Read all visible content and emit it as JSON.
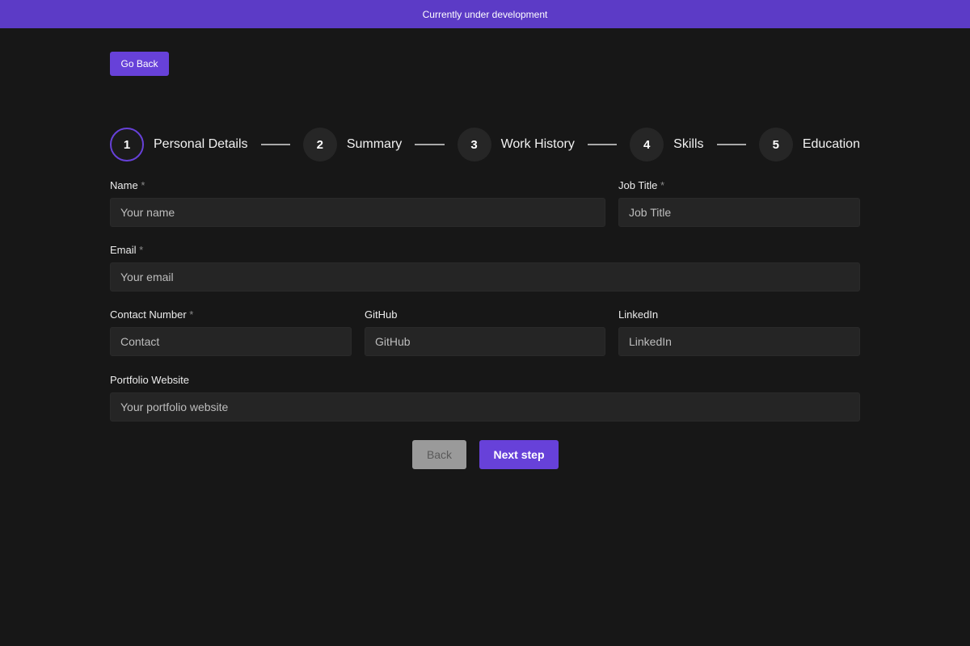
{
  "banner": {
    "text": "Currently under development"
  },
  "nav": {
    "go_back_label": "Go Back"
  },
  "stepper": {
    "steps": [
      {
        "number": "1",
        "label": "Personal Details"
      },
      {
        "number": "2",
        "label": "Summary"
      },
      {
        "number": "3",
        "label": "Work History"
      },
      {
        "number": "4",
        "label": "Skills"
      },
      {
        "number": "5",
        "label": "Education"
      }
    ],
    "active_step": 1
  },
  "form": {
    "required_marker": "*",
    "name": {
      "label": "Name",
      "placeholder": "Your name",
      "value": ""
    },
    "job_title": {
      "label": "Job Title",
      "placeholder": "Job Title",
      "value": ""
    },
    "email": {
      "label": "Email",
      "placeholder": "Your email",
      "value": ""
    },
    "contact": {
      "label": "Contact Number",
      "placeholder": "Contact",
      "value": ""
    },
    "github": {
      "label": "GitHub",
      "placeholder": "GitHub",
      "value": ""
    },
    "linkedin": {
      "label": "LinkedIn",
      "placeholder": "LinkedIn",
      "value": ""
    },
    "portfolio": {
      "label": "Portfolio Website",
      "placeholder": "Your portfolio website",
      "value": ""
    }
  },
  "actions": {
    "back_label": "Back",
    "next_label": "Next step"
  },
  "colors": {
    "accent": "#6741d9",
    "banner": "#5c3bc6",
    "background": "#171717",
    "input_bg": "#252525",
    "disabled_button": "#9a9a9a"
  }
}
